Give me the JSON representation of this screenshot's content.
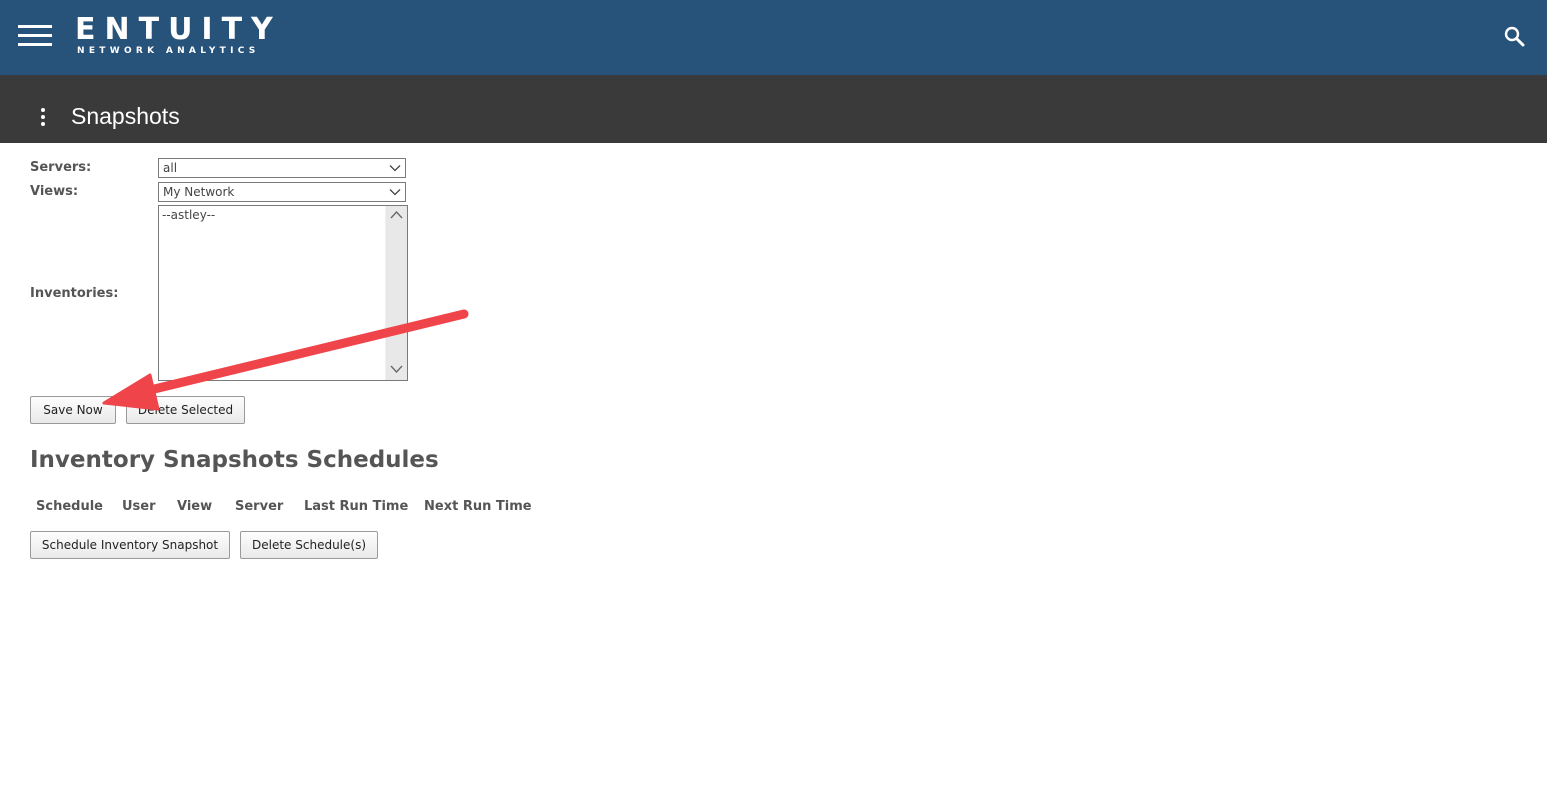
{
  "header": {
    "logo_main": "ENTUITY",
    "logo_sub": "NETWORK ANALYTICS",
    "menu_icon": "hamburger-menu-icon",
    "search_icon": "search-icon",
    "background_color": "#27527a"
  },
  "titlebar": {
    "title": "Snapshots",
    "menu_icon": "kebab-menu-icon",
    "background_color": "#3a3a3a"
  },
  "form": {
    "servers": {
      "label": "Servers:",
      "selected": "all"
    },
    "views": {
      "label": "Views:",
      "selected": "My Network"
    },
    "inventories": {
      "label": "Inventories:",
      "options": [
        "--astley--"
      ]
    }
  },
  "buttons": {
    "save_now": "Save Now",
    "delete_selected": "Delete Selected"
  },
  "schedules": {
    "title": "Inventory Snapshots Schedules",
    "columns": [
      "Schedule",
      "User",
      "View",
      "Server",
      "Last Run Time",
      "Next Run Time"
    ],
    "rows": [],
    "schedule_button": "Schedule Inventory Snapshot",
    "delete_button": "Delete Schedule(s)"
  },
  "annotation": {
    "type": "arrow",
    "color": "#ef4449",
    "points_to": "save-now-button"
  }
}
